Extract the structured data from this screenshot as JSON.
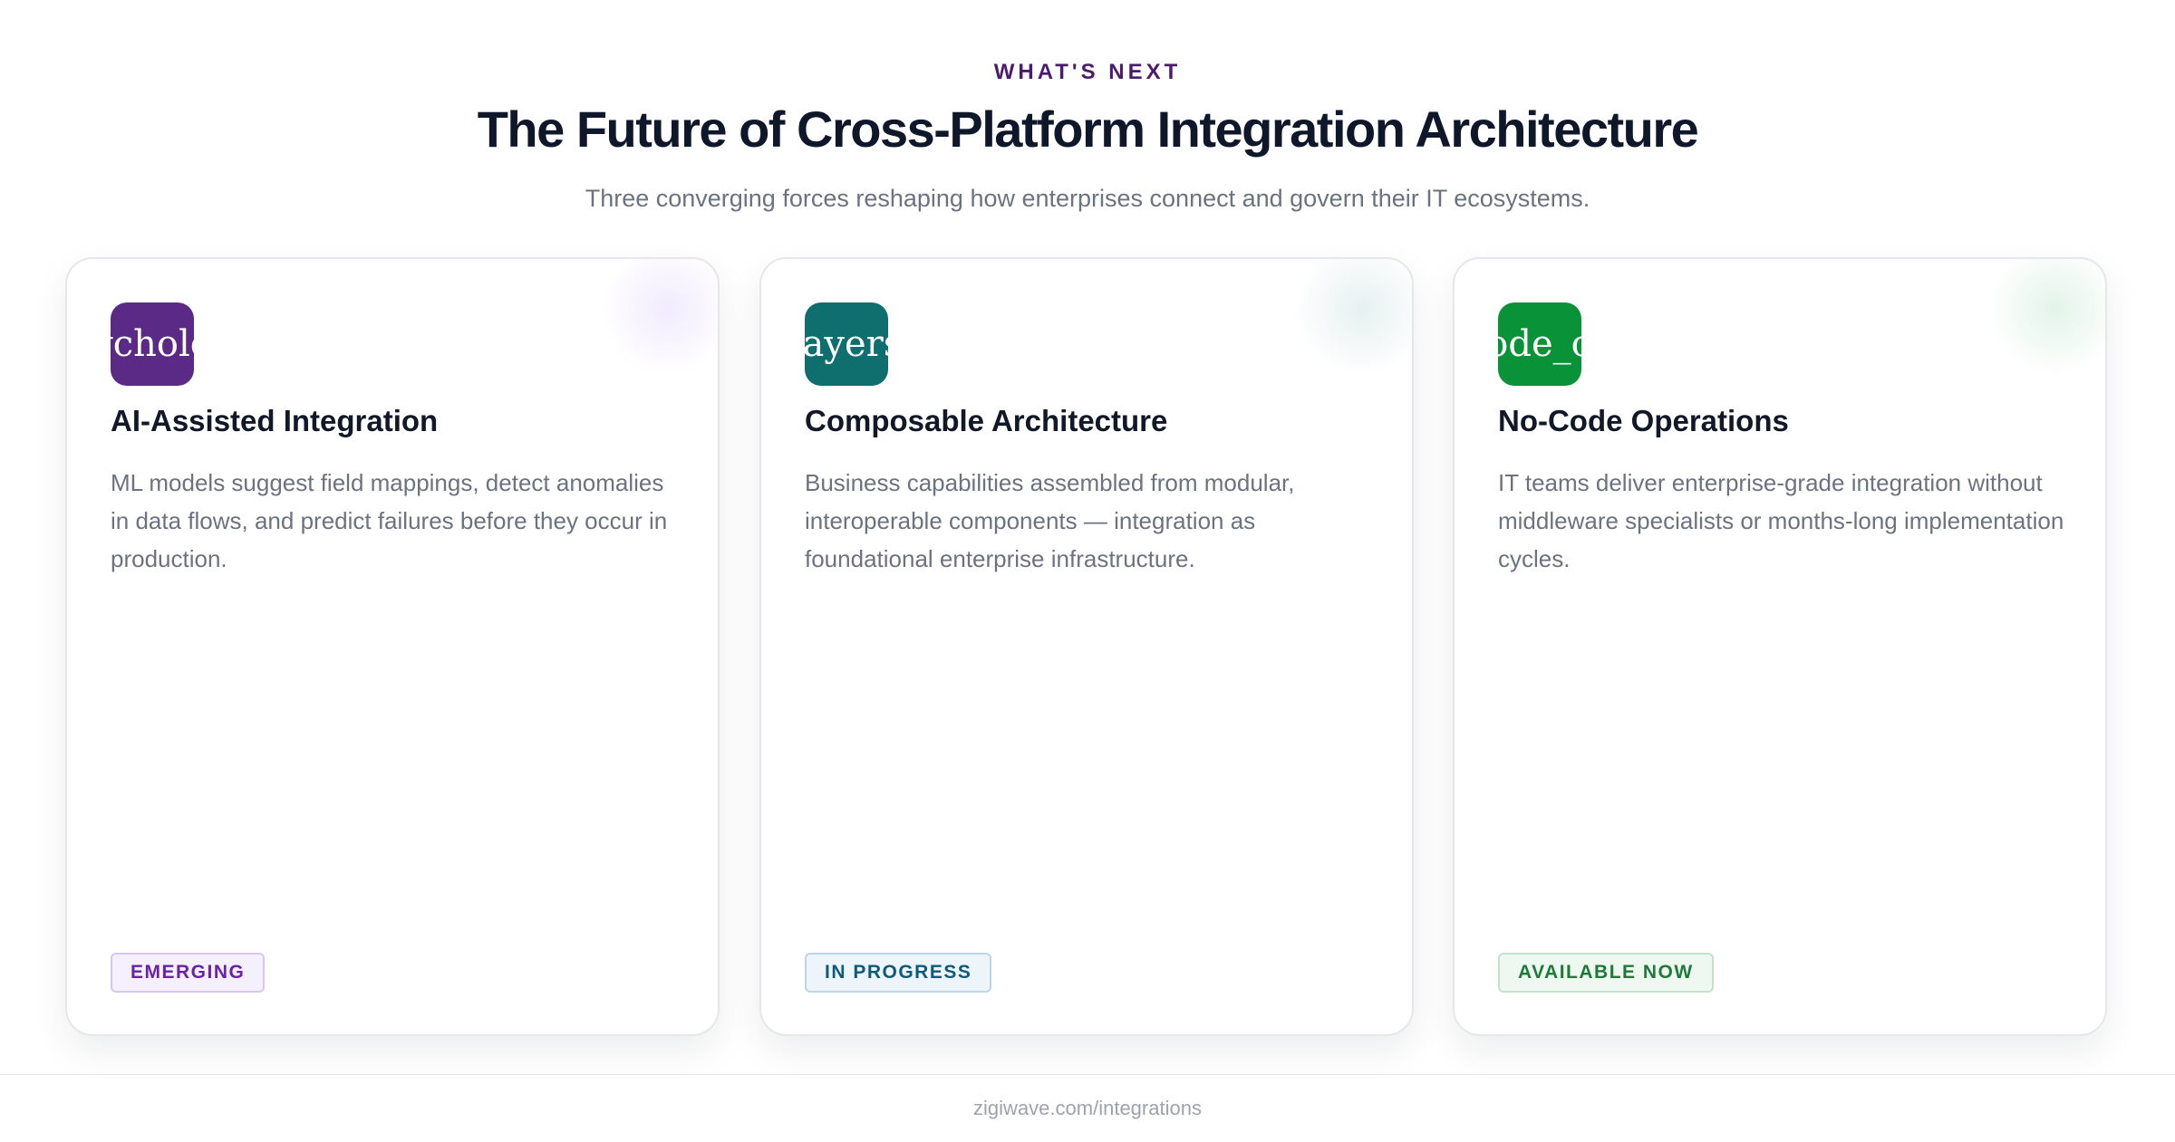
{
  "header": {
    "eyebrow": "WHAT'S NEXT",
    "title": "The Future of Cross-Platform Integration Architecture",
    "subtitle": "Three converging forces reshaping how enterprises connect and govern their IT ecosystems."
  },
  "cards": [
    {
      "icon_text": "ycholo",
      "icon_name": "psychology-icon",
      "icon_color": "#5b2a86",
      "glow_color": "rgba(139, 92, 246, 0.12)",
      "title": "AI-Assisted Integration",
      "description": "ML models suggest field mappings, detect anomalies in data flows, and predict failures before they occur in production.",
      "badge": "EMERGING",
      "badge_text_color": "#6b21a8",
      "badge_bg": "#f5f0fd",
      "badge_border": "#d8c6f2"
    },
    {
      "icon_text": "layers",
      "icon_name": "layers-icon",
      "icon_color": "#0f6e6e",
      "glow_color": "rgba(15, 110, 110, 0.10)",
      "title": "Composable Architecture",
      "description": "Business capabilities assembled from modular, interoperable components — integration as foundational enterprise infrastructure.",
      "badge": "IN PROGRESS",
      "badge_text_color": "#0e5a7a",
      "badge_bg": "#eef5fa",
      "badge_border": "#bcd6e6"
    },
    {
      "icon_text": "ode_o",
      "icon_name": "code-off-icon",
      "icon_color": "#0a9238",
      "glow_color": "rgba(22, 163, 74, 0.12)",
      "title": "No-Code Operations",
      "description": "IT teams deliver enterprise-grade integration without middleware specialists or months-long implementation cycles.",
      "badge": "AVAILABLE NOW",
      "badge_text_color": "#1f7a3a",
      "badge_bg": "#eef8f0",
      "badge_border": "#c2e2ca"
    }
  ],
  "footer": {
    "text": "zigiwave.com/integrations"
  }
}
